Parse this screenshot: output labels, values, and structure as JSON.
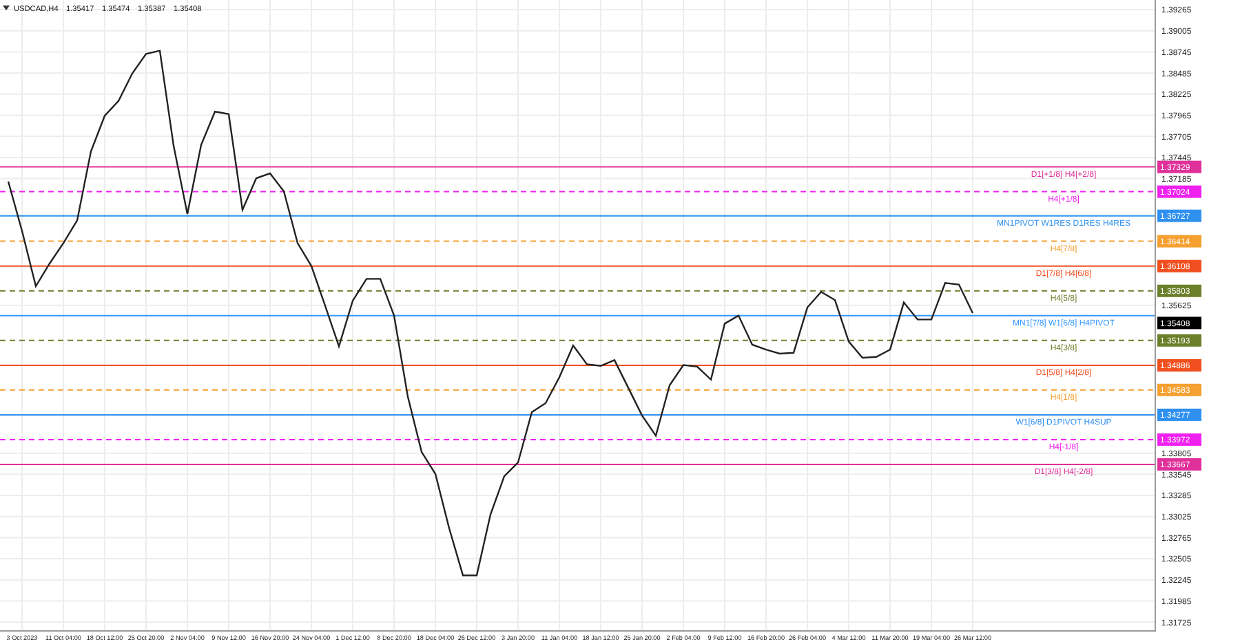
{
  "header": {
    "symbol": "USDCAD,H4",
    "ohlc": [
      "1.35417",
      "1.35474",
      "1.35387",
      "1.35408"
    ]
  },
  "chart": {
    "chart_data": {
      "type": "line",
      "categories": [
        null,
        "3 Oct 2023",
        null,
        null,
        "11 Oct 04:00",
        null,
        null,
        "18 Oct 12:00",
        null,
        null,
        "25 Oct 20:00",
        null,
        null,
        "2 Nov 04:00",
        null,
        null,
        "9 Nov 12:00",
        null,
        null,
        "16 Nov 20:00",
        null,
        null,
        "24 Nov 04:00",
        null,
        null,
        "1 Dec 12:00",
        null,
        null,
        "8 Dec 20:00",
        null,
        null,
        "18 Dec 04:00",
        null,
        null,
        "26 Dec 12:00",
        null,
        null,
        "3 Jan 20:00",
        null,
        null,
        "11 Jan 04:00",
        null,
        null,
        "18 Jan 12:00",
        null,
        null,
        "25 Jan 20:00",
        null,
        null,
        "2 Feb 04:00",
        null,
        null,
        "9 Feb 12:00",
        null,
        null,
        "16 Feb 20:00",
        null,
        null,
        "26 Feb 04:00",
        null,
        null,
        "4 Mar 12:00",
        null,
        null,
        "11 Mar 20:00",
        null,
        null,
        "19 Mar 04:00",
        null,
        null,
        "26 Mar 12:00"
      ],
      "values": [
        1.3715,
        1.3654,
        1.3586,
        1.3614,
        1.3639,
        1.3667,
        1.3752,
        1.3796,
        1.3814,
        1.3848,
        1.3872,
        1.3876,
        1.3759,
        1.3675,
        1.376,
        1.3801,
        1.3798,
        1.368,
        1.3719,
        1.3725,
        1.3703,
        1.3639,
        1.3611,
        1.3562,
        1.3512,
        1.3568,
        1.3595,
        1.3595,
        1.355,
        1.345,
        1.3382,
        1.3355,
        1.3288,
        1.323,
        1.323,
        1.3305,
        1.3352,
        1.3369,
        1.3431,
        1.3442,
        1.3474,
        1.3513,
        1.349,
        1.3488,
        1.3495,
        1.3461,
        1.3427,
        1.3402,
        1.3464,
        1.3489,
        1.3487,
        1.3471,
        1.354,
        1.355,
        1.3514,
        1.3508,
        1.3503,
        1.3504,
        1.356,
        1.3579,
        1.3569,
        1.3518,
        1.3498,
        1.3499,
        1.3508,
        1.3566,
        1.3545,
        1.3545,
        1.359,
        1.3588,
        1.3553
      ],
      "grid": true,
      "ylim": [
        1.31591,
        1.39384
      ],
      "yticks": [
        1.39265,
        1.39005,
        1.38745,
        1.38485,
        1.38225,
        1.37965,
        1.37705,
        1.37445,
        1.37185,
        1.35625,
        1.33805,
        1.33545,
        1.33285,
        1.33025,
        1.32765,
        1.32505,
        1.32245,
        1.31985,
        1.31725
      ],
      "ref_lines": [
        {
          "axis": "y",
          "value": 1.37329,
          "label": "D1[+1/8] H4[+2/8]",
          "color": "#e0309a"
        },
        {
          "axis": "y",
          "value": 1.37024,
          "label": "H4[+1/8]",
          "color": "#f020f0"
        },
        {
          "axis": "y",
          "value": 1.36727,
          "label": "MN1PIVOT W1RES D1RES H4RES",
          "color": "#2f90f0"
        },
        {
          "axis": "y",
          "value": 1.36414,
          "label": "H4[7/8]",
          "color": "#f5a030"
        },
        {
          "axis": "y",
          "value": 1.36108,
          "label": "D1[7/8] H4[6/8]",
          "color": "#f05020"
        },
        {
          "axis": "y",
          "value": 1.35803,
          "label": "H4[5/8]",
          "color": "#6b7f2a"
        },
        {
          "axis": "y",
          "value": 1.35498,
          "label": "MN1[7/8] W1[6/8] H4PIVOT",
          "color": "#3399ff"
        },
        {
          "axis": "y",
          "value": 1.35193,
          "label": "H4[3/8]",
          "color": "#6b7f2a"
        },
        {
          "axis": "y",
          "value": 1.34886,
          "label": "D1[5/8] H4[2/8]",
          "color": "#f05020"
        },
        {
          "axis": "y",
          "value": 1.34583,
          "label": "H4[1/8]",
          "color": "#f5a030"
        },
        {
          "axis": "y",
          "value": 1.34277,
          "label": "W1[6/8] D1PIVOT H4SUP",
          "color": "#2f90f0"
        },
        {
          "axis": "y",
          "value": 1.33972,
          "label": "H4[-1/8]",
          "color": "#f020f0"
        },
        {
          "axis": "y",
          "value": 1.33667,
          "label": "D1[3/8] H4[-2/8]",
          "color": "#e0309a"
        }
      ]
    },
    "price_tags": [
      {
        "text": "1.37329",
        "color": "#e0309a"
      },
      {
        "text": "1.37024",
        "color": "#f020f0"
      },
      {
        "text": "1.36727",
        "color": "#2f90f0"
      },
      {
        "text": "1.36414",
        "color": "#f5a030"
      },
      {
        "text": "1.36108",
        "color": "#f05020"
      },
      {
        "text": "1.35803",
        "color": "#6b7f2a"
      },
      {
        "text": "1.35408",
        "color": "#000000"
      },
      {
        "text": "1.35193",
        "color": "#6b7f2a"
      },
      {
        "text": "1.34886",
        "color": "#f05020"
      },
      {
        "text": "1.34583",
        "color": "#f5a030"
      },
      {
        "text": "1.34277",
        "color": "#2f90f0"
      },
      {
        "text": "1.33972",
        "color": "#f020f0"
      },
      {
        "text": "1.33667",
        "color": "#e0309a"
      }
    ]
  }
}
